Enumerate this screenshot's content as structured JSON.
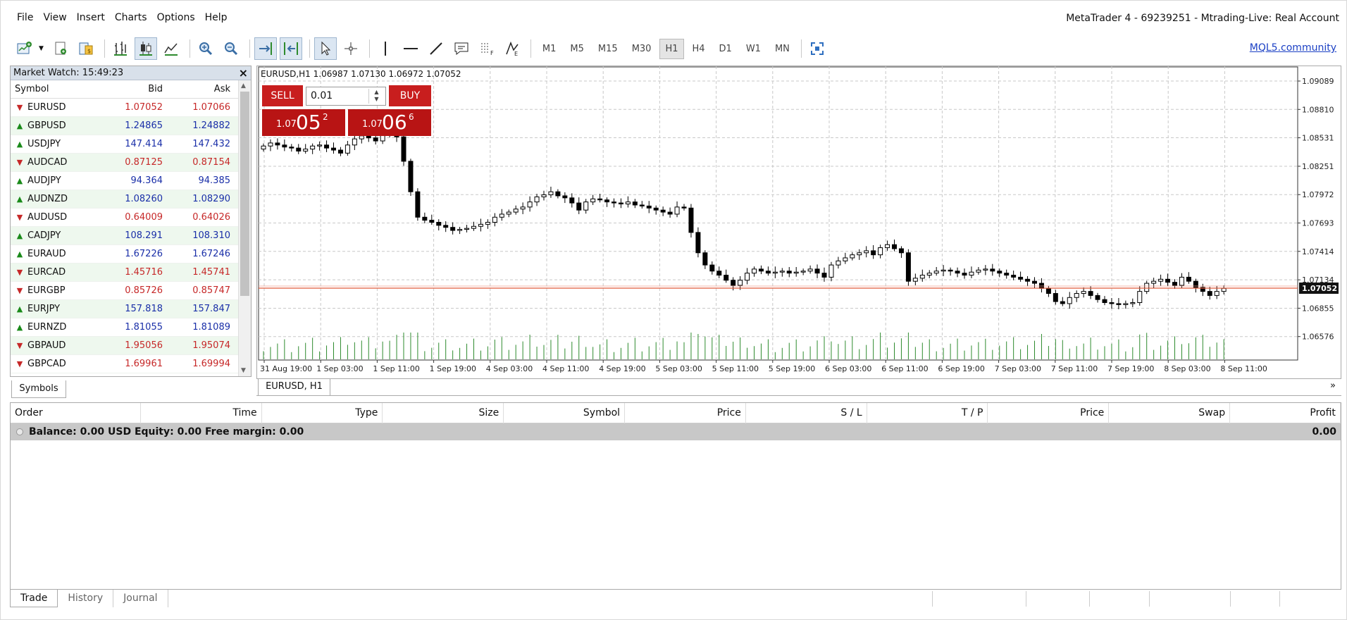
{
  "menu": [
    "File",
    "View",
    "Insert",
    "Charts",
    "Options",
    "Help"
  ],
  "window_title": "MetaTrader 4 - 69239251 - Mtrading-Live: Real Account",
  "toolbar": {
    "timeframes": [
      "M1",
      "M5",
      "M15",
      "M30",
      "H1",
      "H4",
      "D1",
      "W1",
      "MN"
    ],
    "active_timeframe": "H1",
    "mql5_link": "MQL5.community"
  },
  "market_watch": {
    "title": "Market Watch: 15:49:23",
    "close": "×",
    "columns": [
      "Symbol",
      "Bid",
      "Ask"
    ],
    "rows": [
      {
        "symbol": "EURUSD",
        "bid": "1.07052",
        "ask": "1.07066",
        "dir": "down"
      },
      {
        "symbol": "GBPUSD",
        "bid": "1.24865",
        "ask": "1.24882",
        "dir": "up"
      },
      {
        "symbol": "USDJPY",
        "bid": "147.414",
        "ask": "147.432",
        "dir": "up"
      },
      {
        "symbol": "AUDCAD",
        "bid": "0.87125",
        "ask": "0.87154",
        "dir": "down"
      },
      {
        "symbol": "AUDJPY",
        "bid": "94.364",
        "ask": "94.385",
        "dir": "up"
      },
      {
        "symbol": "AUDNZD",
        "bid": "1.08260",
        "ask": "1.08290",
        "dir": "up"
      },
      {
        "symbol": "AUDUSD",
        "bid": "0.64009",
        "ask": "0.64026",
        "dir": "down"
      },
      {
        "symbol": "CADJPY",
        "bid": "108.291",
        "ask": "108.310",
        "dir": "up"
      },
      {
        "symbol": "EURAUD",
        "bid": "1.67226",
        "ask": "1.67246",
        "dir": "up"
      },
      {
        "symbol": "EURCAD",
        "bid": "1.45716",
        "ask": "1.45741",
        "dir": "down"
      },
      {
        "symbol": "EURGBP",
        "bid": "0.85726",
        "ask": "0.85747",
        "dir": "down"
      },
      {
        "symbol": "EURJPY",
        "bid": "157.818",
        "ask": "157.847",
        "dir": "up"
      },
      {
        "symbol": "EURNZD",
        "bid": "1.81055",
        "ask": "1.81089",
        "dir": "up"
      },
      {
        "symbol": "GBPAUD",
        "bid": "1.95056",
        "ask": "1.95074",
        "dir": "down"
      },
      {
        "symbol": "GBPCAD",
        "bid": "1.69961",
        "ask": "1.69994",
        "dir": "down"
      }
    ],
    "tab": "Symbols"
  },
  "chart": {
    "header": "EURUSD,H1  1.06987 1.07130 1.06972 1.07052",
    "tab": "EURUSD, H1",
    "more": "»",
    "sell_label": "SELL",
    "buy_label": "BUY",
    "lot": "0.01",
    "sell_price": {
      "prefix": "1.07",
      "big": "05",
      "sup": "2"
    },
    "buy_price": {
      "prefix": "1.07",
      "big": "06",
      "sup": "6"
    },
    "current_price": "1.07052",
    "colors": {
      "bid_line": "#e05a3a",
      "buttons": "#c81e1e",
      "volume": "#2e8b2e"
    }
  },
  "chart_data": {
    "type": "candlestick",
    "symbol": "EURUSD",
    "timeframe": "H1",
    "y_ticks": [
      "1.09089",
      "1.08810",
      "1.08531",
      "1.08251",
      "1.07972",
      "1.07693",
      "1.07414",
      "1.07134",
      "1.06855",
      "1.06576"
    ],
    "ylim": [
      1.0638,
      1.092
    ],
    "x_ticks": [
      "31 Aug 19:00",
      "1 Sep 03:00",
      "1 Sep 11:00",
      "1 Sep 19:00",
      "4 Sep 03:00",
      "4 Sep 11:00",
      "4 Sep 19:00",
      "5 Sep 03:00",
      "5 Sep 11:00",
      "5 Sep 19:00",
      "6 Sep 03:00",
      "6 Sep 11:00",
      "6 Sep 19:00",
      "7 Sep 03:00",
      "7 Sep 11:00",
      "7 Sep 19:00",
      "8 Sep 03:00",
      "8 Sep 11:00"
    ],
    "close": [
      1.0845,
      1.0848,
      1.0846,
      1.0844,
      1.0843,
      1.084,
      1.0842,
      1.0845,
      1.0846,
      1.0843,
      1.0841,
      1.0838,
      1.0846,
      1.0852,
      1.0855,
      1.0853,
      1.085,
      1.0856,
      1.0858,
      1.0854,
      1.083,
      1.08,
      1.0775,
      1.0772,
      1.077,
      1.0767,
      1.0765,
      1.0762,
      1.0763,
      1.0764,
      1.0766,
      1.0768,
      1.077,
      1.0775,
      1.0778,
      1.078,
      1.0783,
      1.0785,
      1.079,
      1.0795,
      1.0797,
      1.08,
      1.0796,
      1.0794,
      1.0789,
      1.0782,
      1.079,
      1.0793,
      1.0792,
      1.079,
      1.0789,
      1.0788,
      1.079,
      1.0787,
      1.0786,
      1.0784,
      1.0782,
      1.078,
      1.0778,
      1.0785,
      1.0784,
      1.076,
      1.074,
      1.0728,
      1.0722,
      1.0718,
      1.0713,
      1.0708,
      1.0713,
      1.072,
      1.0724,
      1.0722,
      1.072,
      1.0721,
      1.0722,
      1.072,
      1.0721,
      1.0722,
      1.0724,
      1.072,
      1.0716,
      1.0728,
      1.0732,
      1.0735,
      1.0738,
      1.074,
      1.0742,
      1.0738,
      1.0745,
      1.0748,
      1.0744,
      1.074,
      1.0712,
      1.0715,
      1.0718,
      1.072,
      1.0722,
      1.0723,
      1.0722,
      1.072,
      1.0718,
      1.0721,
      1.0723,
      1.0724,
      1.0722,
      1.072,
      1.0718,
      1.0716,
      1.0714,
      1.0712,
      1.071,
      1.0705,
      1.07,
      1.0692,
      1.069,
      1.0696,
      1.07,
      1.0702,
      1.0698,
      1.0694,
      1.0691,
      1.069,
      1.0689,
      1.069,
      1.0691,
      1.0702,
      1.071,
      1.0712,
      1.0714,
      1.0711,
      1.0708,
      1.0716,
      1.0712,
      1.0706,
      1.0702,
      1.0698,
      1.0702,
      1.0705
    ]
  },
  "terminal": {
    "columns": [
      "Order",
      "Time",
      "Type",
      "Size",
      "Symbol",
      "Price",
      "S / L",
      "T / P",
      "Price",
      "Swap",
      "Profit"
    ],
    "balance_text": "Balance: 0.00 USD  Equity: 0.00  Free margin: 0.00",
    "profit": "0.00",
    "tabs": [
      "Trade",
      "History",
      "Journal"
    ]
  }
}
